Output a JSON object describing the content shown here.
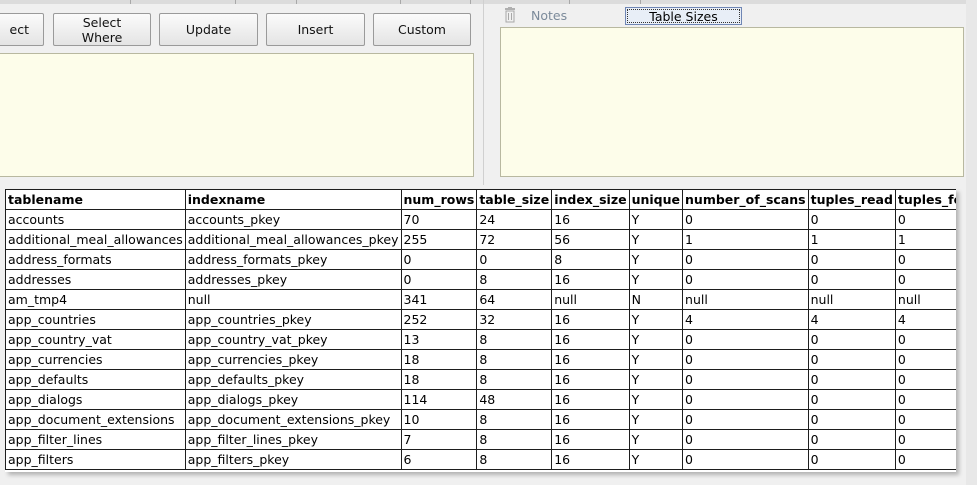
{
  "toolbar": {
    "buttons": [
      {
        "name": "select-button",
        "label": "ect"
      },
      {
        "name": "select-where-button",
        "label": "Select\nWhere"
      },
      {
        "name": "update-button",
        "label": "Update"
      },
      {
        "name": "insert-button",
        "label": "Insert"
      },
      {
        "name": "custom-button",
        "label": "Custom"
      }
    ]
  },
  "side_panel": {
    "notes_label": "Notes",
    "table_sizes_label": "Table Sizes",
    "trash_icon": "trash-icon"
  },
  "colors": {
    "editor_bg": "#fdfdea",
    "window_bg": "#f0f0f0",
    "focus_tab_bg": "#e8eef7"
  },
  "grid": {
    "columns": [
      "tablename",
      "indexname",
      "num_rows",
      "table_size",
      "index_size",
      "unique",
      "number_of_scans",
      "tuples_read",
      "tuples_fetched"
    ],
    "rows": [
      [
        "accounts",
        "accounts_pkey",
        "70",
        "24",
        "16",
        "Y",
        "0",
        "0",
        "0"
      ],
      [
        "additional_meal_allowances",
        "additional_meal_allowances_pkey",
        "255",
        "72",
        "56",
        "Y",
        "1",
        "1",
        "1"
      ],
      [
        "address_formats",
        "address_formats_pkey",
        "0",
        "0",
        "8",
        "Y",
        "0",
        "0",
        "0"
      ],
      [
        "addresses",
        "addresses_pkey",
        "0",
        "8",
        "16",
        "Y",
        "0",
        "0",
        "0"
      ],
      [
        "am_tmp4",
        "null",
        "341",
        "64",
        "null",
        "N",
        "null",
        "null",
        "null"
      ],
      [
        "app_countries",
        "app_countries_pkey",
        "252",
        "32",
        "16",
        "Y",
        "4",
        "4",
        "4"
      ],
      [
        "app_country_vat",
        "app_country_vat_pkey",
        "13",
        "8",
        "16",
        "Y",
        "0",
        "0",
        "0"
      ],
      [
        "app_currencies",
        "app_currencies_pkey",
        "18",
        "8",
        "16",
        "Y",
        "0",
        "0",
        "0"
      ],
      [
        "app_defaults",
        "app_defaults_pkey",
        "18",
        "8",
        "16",
        "Y",
        "0",
        "0",
        "0"
      ],
      [
        "app_dialogs",
        "app_dialogs_pkey",
        "114",
        "48",
        "16",
        "Y",
        "0",
        "0",
        "0"
      ],
      [
        "app_document_extensions",
        "app_document_extensions_pkey",
        "10",
        "8",
        "16",
        "Y",
        "0",
        "0",
        "0"
      ],
      [
        "app_filter_lines",
        "app_filter_lines_pkey",
        "7",
        "8",
        "16",
        "Y",
        "0",
        "0",
        "0"
      ],
      [
        "app_filters",
        "app_filters_pkey",
        "6",
        "8",
        "16",
        "Y",
        "0",
        "0",
        "0"
      ]
    ]
  }
}
